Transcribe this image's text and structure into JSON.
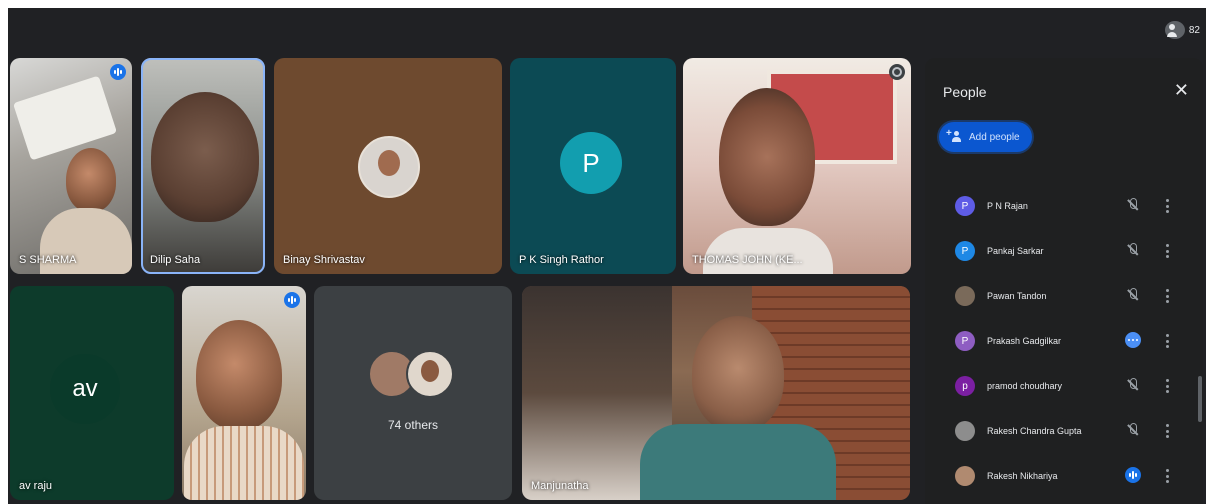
{
  "topbar": {
    "count_label": "82"
  },
  "tiles": [
    {
      "name": "S SHARMA"
    },
    {
      "name": "Dilip Saha"
    },
    {
      "name": "Binay Shrivastav"
    },
    {
      "name": "P K Singh Rathor",
      "initial": "P"
    },
    {
      "name": "THOMAS JOHN (KE..."
    },
    {
      "name": "av raju",
      "initial": "av"
    },
    {
      "name": ""
    },
    {
      "others_label": "74 others"
    },
    {
      "name": "Manjunatha"
    }
  ],
  "panel": {
    "title": "People",
    "close_icon": "close-icon",
    "add_label": "Add people",
    "people": [
      {
        "name": "P N Rajan",
        "initial": "P",
        "color": "#5e5ce6",
        "mic": "muted"
      },
      {
        "name": "Pankaj Sarkar",
        "initial": "P",
        "color": "#1e88e5",
        "mic": "muted"
      },
      {
        "name": "Pawan Tandon",
        "initial": "",
        "color": "#7a6a5a",
        "mic": "muted"
      },
      {
        "name": "Prakash Gadgilkar",
        "initial": "P",
        "color": "#8e5dc2",
        "mic": "more"
      },
      {
        "name": "pramod choudhary",
        "initial": "p",
        "color": "#7b1fa2",
        "mic": "muted"
      },
      {
        "name": "Rakesh Chandra Gupta",
        "initial": "",
        "color": "#8d8d8d",
        "mic": "muted"
      },
      {
        "name": "Rakesh Nikhariya",
        "initial": "",
        "color": "#b08a70",
        "mic": "speaking"
      }
    ]
  }
}
